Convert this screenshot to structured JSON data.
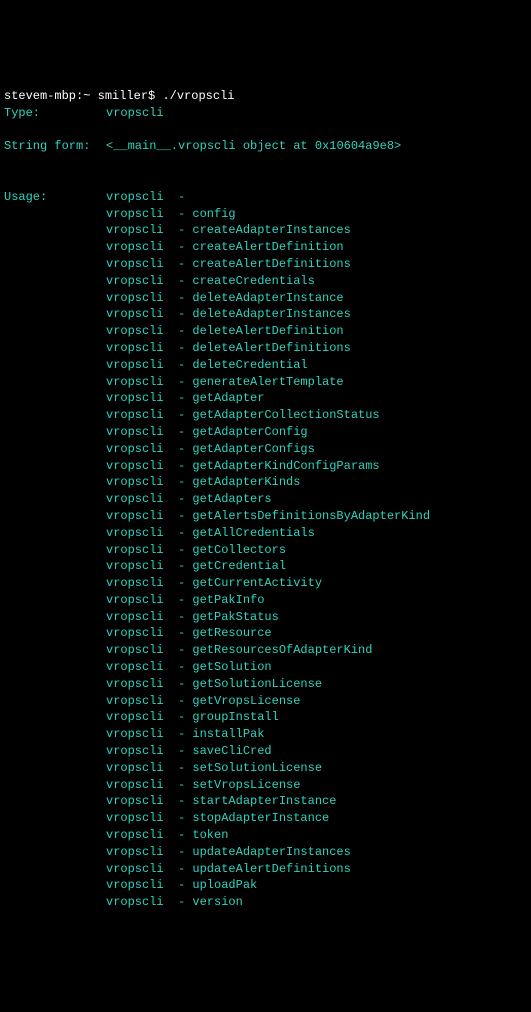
{
  "prompt": {
    "host": "stevem-mbp",
    "separator1": ":",
    "path": "~",
    "user": "smiller",
    "dollar": "$",
    "command": "./vropscli"
  },
  "typeLine": {
    "label": "Type:",
    "value": "vropscli"
  },
  "stringForm": {
    "label": "String form:",
    "value": "<__main__.vropscli object at 0x10604a9e8>"
  },
  "usage": {
    "label": "Usage:",
    "program": "vropscli",
    "dash": "-",
    "commands": [
      "",
      "config",
      "createAdapterInstances",
      "createAlertDefinition",
      "createAlertDefinitions",
      "createCredentials",
      "deleteAdapterInstance",
      "deleteAdapterInstances",
      "deleteAlertDefinition",
      "deleteAlertDefinitions",
      "deleteCredential",
      "generateAlertTemplate",
      "getAdapter",
      "getAdapterCollectionStatus",
      "getAdapterConfig",
      "getAdapterConfigs",
      "getAdapterKindConfigParams",
      "getAdapterKinds",
      "getAdapters",
      "getAlertsDefinitionsByAdapterKind",
      "getAllCredentials",
      "getCollectors",
      "getCredential",
      "getCurrentActivity",
      "getPakInfo",
      "getPakStatus",
      "getResource",
      "getResourcesOfAdapterKind",
      "getSolution",
      "getSolutionLicense",
      "getVropsLicense",
      "groupInstall",
      "installPak",
      "saveCliCred",
      "setSolutionLicense",
      "setVropsLicense",
      "startAdapterInstance",
      "stopAdapterInstance",
      "token",
      "updateAdapterInstances",
      "updateAlertDefinitions",
      "uploadPak",
      "version"
    ]
  }
}
